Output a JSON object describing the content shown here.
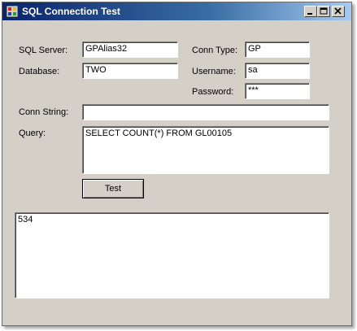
{
  "window": {
    "title": "SQL Connection Test"
  },
  "form": {
    "sql_server_label": "SQL Server:",
    "sql_server_value": "GPAlias32",
    "database_label": "Database:",
    "database_value": "TWO",
    "conn_type_label": "Conn Type:",
    "conn_type_value": "GP",
    "username_label": "Username:",
    "username_value": "sa",
    "password_label": "Password:",
    "password_value": "***",
    "conn_string_label": "Conn String:",
    "conn_string_value": "",
    "query_label": "Query:",
    "query_value": "SELECT COUNT(*) FROM GL00105",
    "test_button_label": "Test"
  },
  "output": {
    "result_value": "534"
  },
  "icons": {
    "app": "app-icon",
    "minimize": "minimize-icon",
    "maximize": "maximize-icon",
    "close": "close-icon"
  },
  "colors": {
    "titlebar_start": "#0a246a",
    "titlebar_end": "#a6caf0",
    "window_face": "#d4d0c8"
  }
}
